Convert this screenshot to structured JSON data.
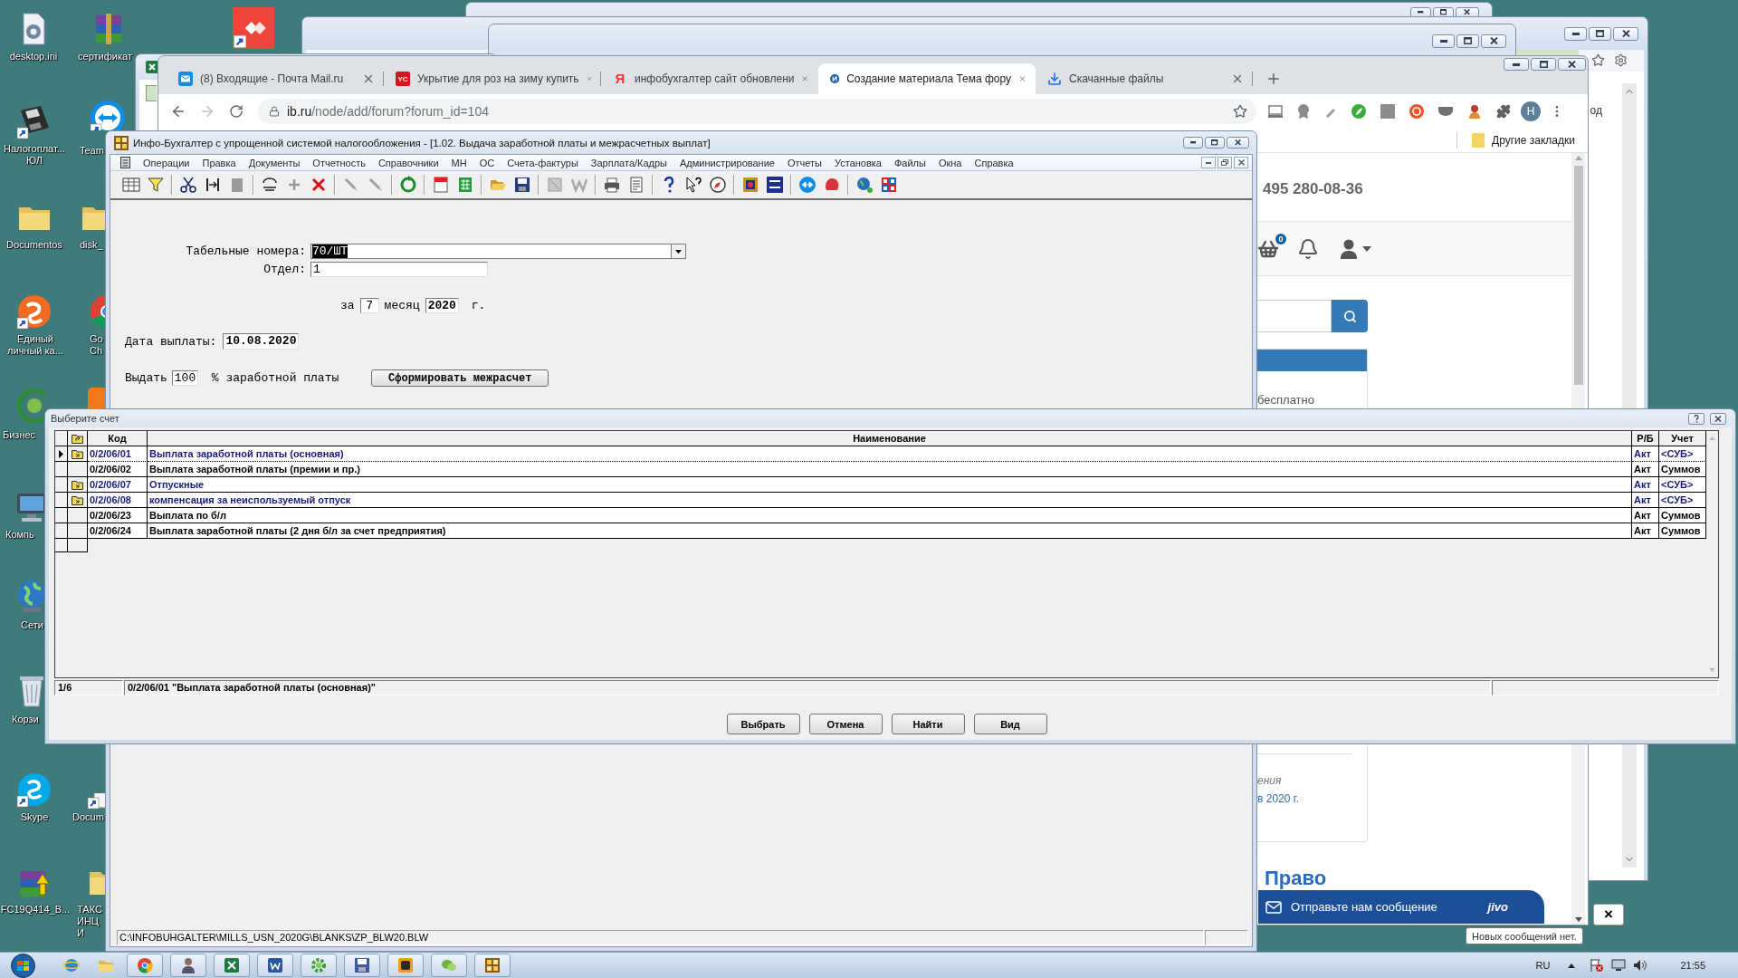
{
  "desktop_icons": [
    {
      "label": "desktop.ini",
      "kind": "settings-file",
      "shortcut": false
    },
    {
      "label": "сертификат",
      "kind": "archive",
      "shortcut": false
    },
    {
      "kind": "red-app",
      "shortcut": true
    },
    {
      "label": "Налогоплат... ЮЛ",
      "kind": "diskette",
      "shortcut": true
    },
    {
      "label": "Team",
      "kind": "remote",
      "shortcut": true
    },
    {
      "label": "Documentos",
      "kind": "folder",
      "shortcut": false
    },
    {
      "label": "disk_",
      "kind": "folder",
      "shortcut": false
    },
    {
      "label": "Единый личный ка...",
      "kind": "orange-logo",
      "shortcut": true
    },
    {
      "label": "Go Ch",
      "kind": "chrome",
      "shortcut": false
    },
    {
      "label": "Бизнес",
      "kind": "cycle",
      "shortcut": false
    },
    {
      "kind": "orange-app"
    },
    {
      "label": "Компь",
      "kind": "computer",
      "shortcut": false
    },
    {
      "label": "Сети",
      "kind": "globe",
      "shortcut": false
    },
    {
      "label": "Корзи",
      "kind": "recycle",
      "shortcut": false
    },
    {
      "label": "Skype",
      "kind": "skype",
      "shortcut": true
    },
    {
      "label": "Docum",
      "kind": "document",
      "shortcut": true
    },
    {
      "label": "FC19Q414_B...",
      "kind": "installer",
      "shortcut": false
    },
    {
      "label": "ТАКС ИНЦИ",
      "kind": "folder",
      "shortcut": false
    }
  ],
  "back_window": {
    "side_text": "од"
  },
  "browser": {
    "tabs": [
      {
        "title": "(8) Входящие - Почта Mail.ru",
        "kind": "mail",
        "selected": false
      },
      {
        "title": "Укрытие для роз на зиму купить",
        "kind": "tile",
        "icon_text": "YC",
        "selected": false
      },
      {
        "title": "инфобухгалтер сайт обновлени",
        "kind": "letter",
        "icon_text": "Я",
        "selected": false
      },
      {
        "title": "Создание материала Тема фору",
        "kind": "circle-logo",
        "selected": true
      },
      {
        "title": "Скачанные файлы",
        "kind": "download",
        "selected": false
      }
    ],
    "address_host": "ib.ru",
    "address_path": "/node/add/forum?forum_id=104",
    "profile_initial": "H",
    "bookmark_folder": "Другие закладки",
    "page": {
      "phone": "495 280-08-36",
      "cart_count": "0",
      "promo": "бесплатно",
      "card_lines": [
        "ения",
        "в 2020 г."
      ],
      "heading": "Право"
    }
  },
  "chat": {
    "label": "Отправьте нам сообщение",
    "brand": "jivo",
    "close": "×",
    "tooltip": "Новых сообщений нет."
  },
  "app": {
    "title": "Инфо-Бухгалтер с упрощенной системой налогообложения - [1.02. Выдача заработной платы и межрасчетных выплат]",
    "menu": [
      "Операции",
      "Правка",
      "Документы",
      "Отчетность",
      "Справочники",
      "МН",
      "ОС",
      "Счета-фактуры",
      "Зарплата/Кадры",
      "Администрирование",
      "Отчеты",
      "Установка",
      "Файлы",
      "Окна",
      "Справка"
    ],
    "form": {
      "employee_label": "Табельные номера:",
      "employee_value": "70/ШТ",
      "employee_selected": true,
      "department_label": "Отдел:",
      "department_value": "1",
      "period_prefix": "за",
      "month": "7",
      "month_label": "месяц",
      "year": "2020",
      "year_suffix": "г.",
      "payment_date_label": "Дата выплаты:",
      "payment_date": "10.08.2020",
      "pay_label": "Выдать",
      "pay_percent": "100",
      "pay_suffix": "% заработной платы",
      "button": "Сформировать межрасчет"
    },
    "status_path": "C:\\INFOBUHGALTER\\MILLS_USN_2020G\\BLANKS\\ZP_BLW20.BLW"
  },
  "dialog": {
    "title": "Выберите счет",
    "columns": [
      "Код",
      "Наименование",
      "Р/Б",
      "Учет"
    ],
    "rows": [
      {
        "code": "0/2/06/01",
        "name": "Выплата заработной платы (основная)",
        "rb": "Акт",
        "account": "<СУБ>",
        "folder": true,
        "selected": true
      },
      {
        "code": "0/2/06/02",
        "name": "Выплата заработной платы (премии и пр.)",
        "rb": "Акт",
        "account": "Суммов",
        "folder": false,
        "selected": false
      },
      {
        "code": "0/2/06/07",
        "name": "Отпускные",
        "rb": "Акт",
        "account": "<СУБ>",
        "folder": true,
        "selected": false
      },
      {
        "code": "0/2/06/08",
        "name": "компенсация за неиспользуемый отпуск",
        "rb": "Акт",
        "account": "<СУБ>",
        "folder": true,
        "selected": false
      },
      {
        "code": "0/2/06/23",
        "name": "Выплата по б/л",
        "rb": "Акт",
        "account": "Суммов",
        "folder": false,
        "selected": false
      },
      {
        "code": "0/2/06/24",
        "name": "Выплата заработной платы (2 дня б/л за счет предприятия)",
        "rb": "Акт",
        "account": "Суммов",
        "folder": false,
        "selected": false
      }
    ],
    "position": "1/6",
    "current": "0/2/06/01 \"Выплата заработной платы (основная)\"",
    "buttons": [
      "Выбрать",
      "Отмена",
      "Найти",
      "Вид"
    ]
  },
  "taskbar": {
    "language": "RU",
    "time": "21:55"
  }
}
